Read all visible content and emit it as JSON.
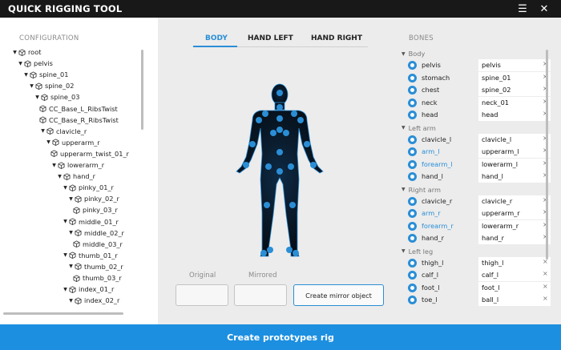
{
  "app": {
    "title": "QUICK RIGGING TOOL"
  },
  "config": {
    "label": "CONFIGURATION",
    "tree": [
      {
        "label": "root",
        "depth": 0,
        "expanded": true
      },
      {
        "label": "pelvis",
        "depth": 1,
        "expanded": true
      },
      {
        "label": "spine_01",
        "depth": 2,
        "expanded": true
      },
      {
        "label": "spine_02",
        "depth": 3,
        "expanded": true
      },
      {
        "label": "spine_03",
        "depth": 4,
        "expanded": true
      },
      {
        "label": "CC_Base_L_RibsTwist",
        "depth": 5,
        "expanded": false
      },
      {
        "label": "CC_Base_R_RibsTwist",
        "depth": 5,
        "expanded": false
      },
      {
        "label": "clavicle_r",
        "depth": 5,
        "expanded": true
      },
      {
        "label": "upperarm_r",
        "depth": 6,
        "expanded": true
      },
      {
        "label": "upperarm_twist_01_r",
        "depth": 7,
        "expanded": false
      },
      {
        "label": "lowerarm_r",
        "depth": 7,
        "expanded": true
      },
      {
        "label": "hand_r",
        "depth": 8,
        "expanded": true
      },
      {
        "label": "pinky_01_r",
        "depth": 9,
        "expanded": true
      },
      {
        "label": "pinky_02_r",
        "depth": 10,
        "expanded": true
      },
      {
        "label": "pinky_03_r",
        "depth": 11,
        "expanded": false
      },
      {
        "label": "middle_01_r",
        "depth": 9,
        "expanded": true
      },
      {
        "label": "middle_02_r",
        "depth": 10,
        "expanded": true
      },
      {
        "label": "middle_03_r",
        "depth": 11,
        "expanded": false
      },
      {
        "label": "thumb_01_r",
        "depth": 9,
        "expanded": true
      },
      {
        "label": "thumb_02_r",
        "depth": 10,
        "expanded": true
      },
      {
        "label": "thumb_03_r",
        "depth": 11,
        "expanded": false
      },
      {
        "label": "index_01_r",
        "depth": 9,
        "expanded": true
      },
      {
        "label": "index_02_r",
        "depth": 10,
        "expanded": true
      }
    ]
  },
  "tabs": [
    {
      "label": "BODY",
      "active": true
    },
    {
      "label": "HAND LEFT",
      "active": false
    },
    {
      "label": "HAND RIGHT",
      "active": false
    }
  ],
  "mirror": {
    "original_label": "Original",
    "mirrored_label": "Mirrored",
    "button_label": "Create mirror object"
  },
  "bones": {
    "label": "BONES",
    "groups": [
      {
        "name": "Body",
        "items": [
          {
            "name": "pelvis",
            "value": "pelvis",
            "highlight": false
          },
          {
            "name": "stomach",
            "value": "spine_01",
            "highlight": false
          },
          {
            "name": "chest",
            "value": "spine_02",
            "highlight": false
          },
          {
            "name": "neck",
            "value": "neck_01",
            "highlight": false
          },
          {
            "name": "head",
            "value": "head",
            "highlight": false
          }
        ]
      },
      {
        "name": "Left arm",
        "items": [
          {
            "name": "clavicle_l",
            "value": "clavicle_l",
            "highlight": false
          },
          {
            "name": "arm_l",
            "value": "upperarm_l",
            "highlight": true
          },
          {
            "name": "forearm_l",
            "value": "lowerarm_l",
            "highlight": true
          },
          {
            "name": "hand_l",
            "value": "hand_l",
            "highlight": false
          }
        ]
      },
      {
        "name": "Right arm",
        "items": [
          {
            "name": "clavicle_r",
            "value": "clavicle_r",
            "highlight": false
          },
          {
            "name": "arm_r",
            "value": "upperarm_r",
            "highlight": true
          },
          {
            "name": "forearm_r",
            "value": "lowerarm_r",
            "highlight": true
          },
          {
            "name": "hand_r",
            "value": "hand_r",
            "highlight": false
          }
        ]
      },
      {
        "name": "Left leg",
        "items": [
          {
            "name": "thigh_l",
            "value": "thigh_l",
            "highlight": false
          },
          {
            "name": "calf_l",
            "value": "calf_l",
            "highlight": false
          },
          {
            "name": "foot_l",
            "value": "foot_l",
            "highlight": false
          },
          {
            "name": "toe_l",
            "value": "ball_l",
            "highlight": false
          }
        ]
      }
    ]
  },
  "footer": {
    "button_label": "Create prototypes rig"
  },
  "colors": {
    "accent": "#2a8ed6",
    "footer": "#1c8fe0",
    "titlebar": "#181818"
  }
}
